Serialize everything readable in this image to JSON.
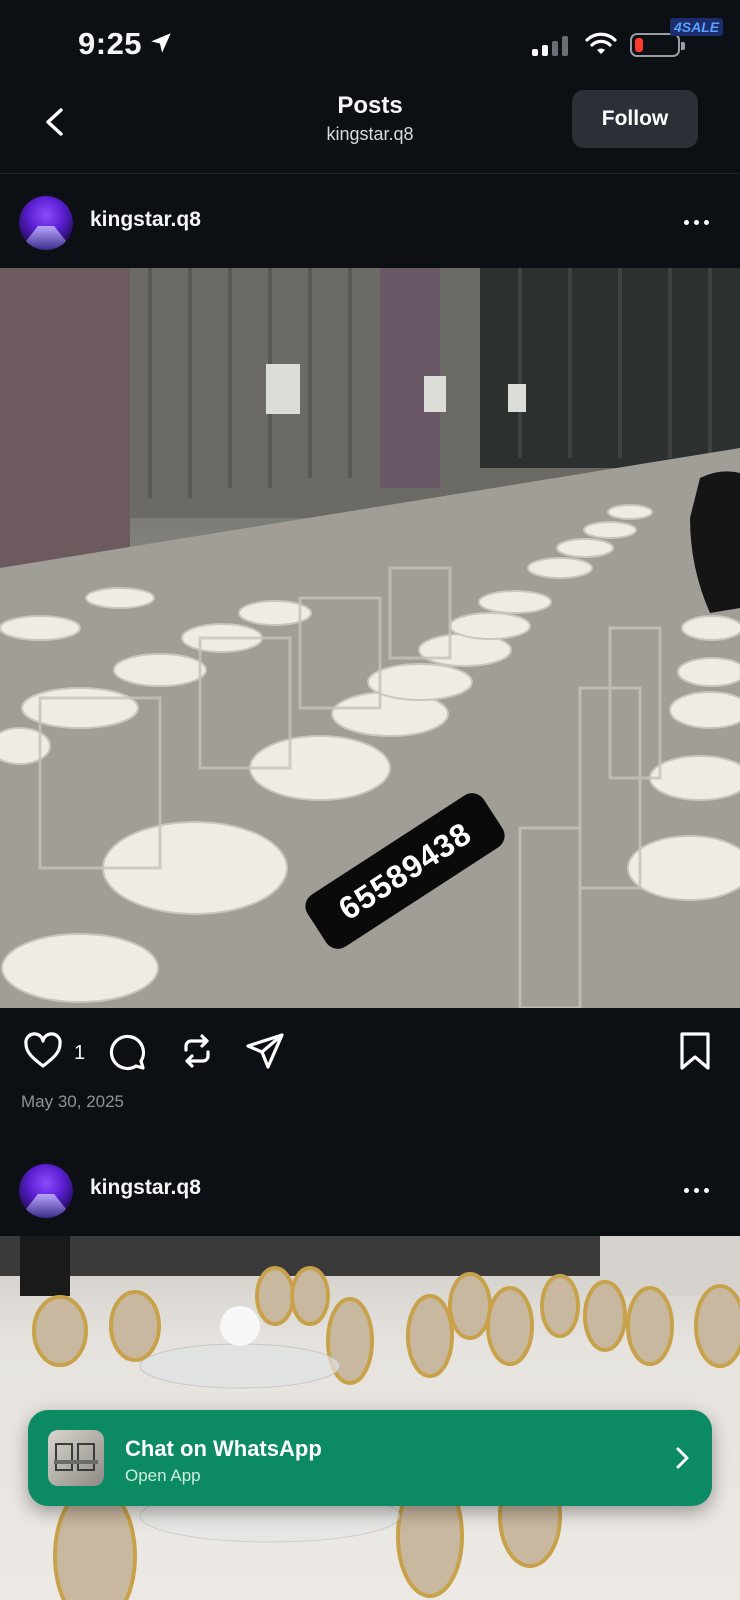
{
  "status_bar": {
    "time": "9:25",
    "badge": "4SALE",
    "location_icon": "location-arrow-icon",
    "signal_icon": "cellular-signal-icon",
    "wifi_icon": "wifi-icon",
    "battery_icon": "battery-low-icon",
    "battery_level": 0.1,
    "signal_bars_active": 2,
    "signal_bars_total": 4,
    "battery_color": "#ff3b30"
  },
  "header": {
    "title": "Posts",
    "subtitle": "kingstar.q8",
    "follow_label": "Follow",
    "back_icon": "chevron-left-icon"
  },
  "posts": [
    {
      "username": "kingstar.q8",
      "image_overlay_text": "65589438",
      "like_count": "1",
      "date": "May 30, 2025"
    },
    {
      "username": "kingstar.q8"
    }
  ],
  "actions": {
    "like_icon": "heart-icon",
    "comment_icon": "comment-icon",
    "repost_icon": "repost-icon",
    "share_icon": "send-icon",
    "save_icon": "bookmark-icon",
    "more_icon": "more-horizontal-icon"
  },
  "whatsapp_banner": {
    "title": "Chat on WhatsApp",
    "subtitle": "Open App",
    "chevron_icon": "chevron-right-icon",
    "color": "#0b8a63"
  },
  "colors": {
    "background": "#0c1014",
    "follow_button": "#2b3036",
    "muted_text": "#8e9399"
  }
}
